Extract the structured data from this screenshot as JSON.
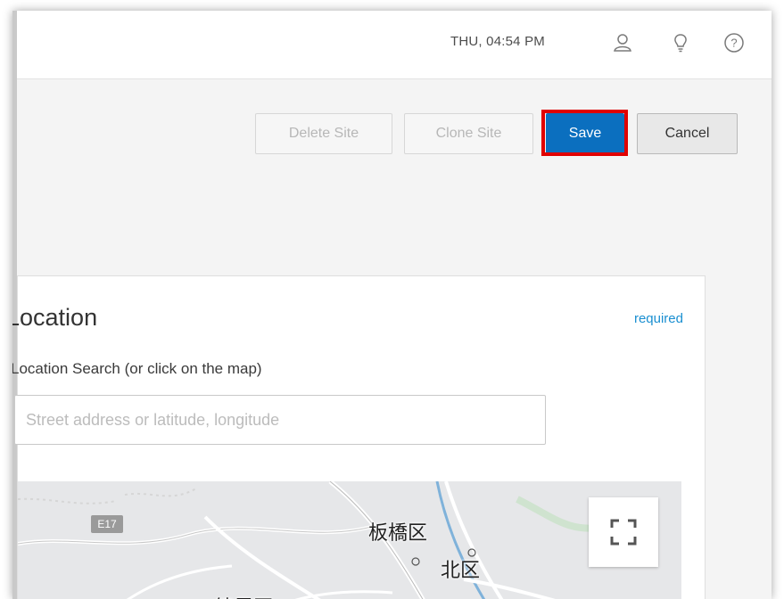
{
  "header": {
    "datetime": "THU, 04:54 PM",
    "icons": [
      "user-icon",
      "lightbulb-icon",
      "help-icon"
    ]
  },
  "toolbar": {
    "delete_label": "Delete Site",
    "clone_label": "Clone Site",
    "save_label": "Save",
    "cancel_label": "Cancel"
  },
  "location": {
    "title": "Location",
    "required_text": "required",
    "search_label": "Location Search (or click on the map)",
    "search_placeholder": "Street address or latitude, longitude",
    "search_value": ""
  },
  "map": {
    "labels": {
      "itabashi": "板橋区",
      "kita": "北区",
      "nerima": "練馬区"
    },
    "road_badge": "E17"
  },
  "colors": {
    "accent": "#0b6fbf",
    "highlight": "#e00000",
    "link": "#1a8fd1"
  }
}
